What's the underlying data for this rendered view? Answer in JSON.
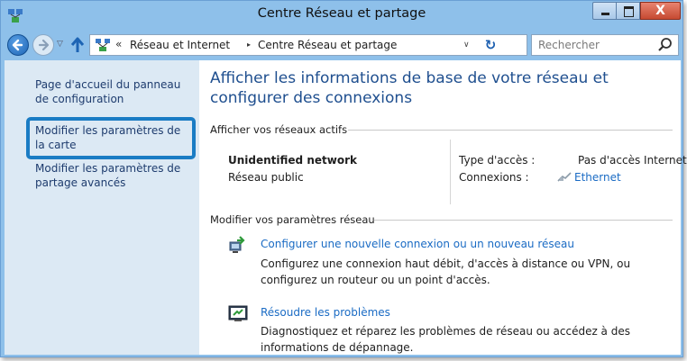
{
  "window": {
    "title": "Centre Réseau et partage",
    "close_glyph": "X"
  },
  "nav": {
    "breadcrumb": [
      "Réseau et Internet",
      "Centre Réseau et partage"
    ],
    "breadcrumb_prefix": "«",
    "separator": "▸",
    "search_placeholder": "Rechercher"
  },
  "sidebar": {
    "items": [
      {
        "label": "Page d'accueil du panneau de configuration"
      },
      {
        "label": "Modifier les paramètres de la carte",
        "highlighted": true
      },
      {
        "label": "Modifier les paramètres de partage avancés"
      }
    ]
  },
  "main": {
    "title": "Afficher les informations de base de votre réseau et configurer des connexions",
    "active_section": "Afficher vos réseaux actifs",
    "network": {
      "name": "Unidentified network",
      "category": "Réseau public",
      "access_label": "Type d'accès :",
      "access_value": "Pas d'accès Internet",
      "connections_label": "Connexions :",
      "connection_link": "Ethernet"
    },
    "settings_section": "Modifier vos paramètres réseau",
    "tasks": [
      {
        "icon": "network-setup-icon",
        "link": "Configurer une nouvelle connexion ou un nouveau réseau",
        "description": "Configurez une connexion haut débit, d'accès à distance ou VPN, ou configurez un routeur ou un point d'accès."
      },
      {
        "icon": "troubleshoot-icon",
        "link": "Résoudre les problèmes",
        "description": "Diagnostiquez et réparez les problèmes de réseau ou accédez à des informations de dépannage."
      }
    ]
  },
  "colors": {
    "chrome": "#8ec0ea",
    "sidebar": "#dce9f4",
    "link": "#1a6bc4",
    "title": "#1f4f8f",
    "highlight": "#1a7cc4"
  }
}
